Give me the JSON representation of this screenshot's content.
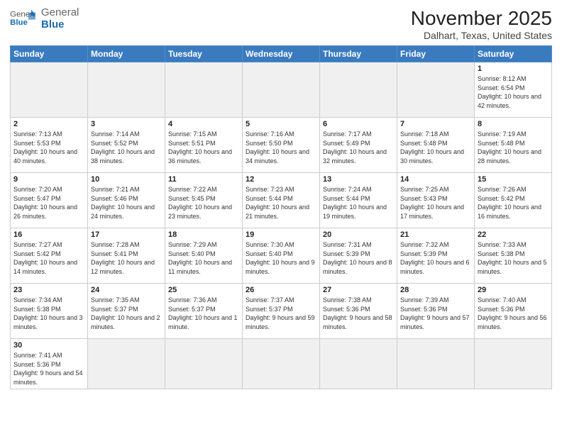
{
  "logo": {
    "text_general": "General",
    "text_blue": "Blue"
  },
  "title": "November 2025",
  "subtitle": "Dalhart, Texas, United States",
  "weekdays": [
    "Sunday",
    "Monday",
    "Tuesday",
    "Wednesday",
    "Thursday",
    "Friday",
    "Saturday"
  ],
  "weeks": [
    [
      {
        "day": "",
        "info": "",
        "empty": true
      },
      {
        "day": "",
        "info": "",
        "empty": true
      },
      {
        "day": "",
        "info": "",
        "empty": true
      },
      {
        "day": "",
        "info": "",
        "empty": true
      },
      {
        "day": "",
        "info": "",
        "empty": true
      },
      {
        "day": "",
        "info": "",
        "empty": true
      },
      {
        "day": "1",
        "info": "Sunrise: 8:12 AM\nSunset: 6:54 PM\nDaylight: 10 hours\nand 42 minutes.",
        "empty": false
      }
    ],
    [
      {
        "day": "2",
        "info": "Sunrise: 7:13 AM\nSunset: 5:53 PM\nDaylight: 10 hours\nand 40 minutes.",
        "empty": false
      },
      {
        "day": "3",
        "info": "Sunrise: 7:14 AM\nSunset: 5:52 PM\nDaylight: 10 hours\nand 38 minutes.",
        "empty": false
      },
      {
        "day": "4",
        "info": "Sunrise: 7:15 AM\nSunset: 5:51 PM\nDaylight: 10 hours\nand 36 minutes.",
        "empty": false
      },
      {
        "day": "5",
        "info": "Sunrise: 7:16 AM\nSunset: 5:50 PM\nDaylight: 10 hours\nand 34 minutes.",
        "empty": false
      },
      {
        "day": "6",
        "info": "Sunrise: 7:17 AM\nSunset: 5:49 PM\nDaylight: 10 hours\nand 32 minutes.",
        "empty": false
      },
      {
        "day": "7",
        "info": "Sunrise: 7:18 AM\nSunset: 5:48 PM\nDaylight: 10 hours\nand 30 minutes.",
        "empty": false
      },
      {
        "day": "8",
        "info": "Sunrise: 7:19 AM\nSunset: 5:48 PM\nDaylight: 10 hours\nand 28 minutes.",
        "empty": false
      }
    ],
    [
      {
        "day": "9",
        "info": "Sunrise: 7:20 AM\nSunset: 5:47 PM\nDaylight: 10 hours\nand 26 minutes.",
        "empty": false
      },
      {
        "day": "10",
        "info": "Sunrise: 7:21 AM\nSunset: 5:46 PM\nDaylight: 10 hours\nand 24 minutes.",
        "empty": false
      },
      {
        "day": "11",
        "info": "Sunrise: 7:22 AM\nSunset: 5:45 PM\nDaylight: 10 hours\nand 23 minutes.",
        "empty": false
      },
      {
        "day": "12",
        "info": "Sunrise: 7:23 AM\nSunset: 5:44 PM\nDaylight: 10 hours\nand 21 minutes.",
        "empty": false
      },
      {
        "day": "13",
        "info": "Sunrise: 7:24 AM\nSunset: 5:44 PM\nDaylight: 10 hours\nand 19 minutes.",
        "empty": false
      },
      {
        "day": "14",
        "info": "Sunrise: 7:25 AM\nSunset: 5:43 PM\nDaylight: 10 hours\nand 17 minutes.",
        "empty": false
      },
      {
        "day": "15",
        "info": "Sunrise: 7:26 AM\nSunset: 5:42 PM\nDaylight: 10 hours\nand 16 minutes.",
        "empty": false
      }
    ],
    [
      {
        "day": "16",
        "info": "Sunrise: 7:27 AM\nSunset: 5:42 PM\nDaylight: 10 hours\nand 14 minutes.",
        "empty": false
      },
      {
        "day": "17",
        "info": "Sunrise: 7:28 AM\nSunset: 5:41 PM\nDaylight: 10 hours\nand 12 minutes.",
        "empty": false
      },
      {
        "day": "18",
        "info": "Sunrise: 7:29 AM\nSunset: 5:40 PM\nDaylight: 10 hours\nand 11 minutes.",
        "empty": false
      },
      {
        "day": "19",
        "info": "Sunrise: 7:30 AM\nSunset: 5:40 PM\nDaylight: 10 hours\nand 9 minutes.",
        "empty": false
      },
      {
        "day": "20",
        "info": "Sunrise: 7:31 AM\nSunset: 5:39 PM\nDaylight: 10 hours\nand 8 minutes.",
        "empty": false
      },
      {
        "day": "21",
        "info": "Sunrise: 7:32 AM\nSunset: 5:39 PM\nDaylight: 10 hours\nand 6 minutes.",
        "empty": false
      },
      {
        "day": "22",
        "info": "Sunrise: 7:33 AM\nSunset: 5:38 PM\nDaylight: 10 hours\nand 5 minutes.",
        "empty": false
      }
    ],
    [
      {
        "day": "23",
        "info": "Sunrise: 7:34 AM\nSunset: 5:38 PM\nDaylight: 10 hours\nand 3 minutes.",
        "empty": false
      },
      {
        "day": "24",
        "info": "Sunrise: 7:35 AM\nSunset: 5:37 PM\nDaylight: 10 hours\nand 2 minutes.",
        "empty": false
      },
      {
        "day": "25",
        "info": "Sunrise: 7:36 AM\nSunset: 5:37 PM\nDaylight: 10 hours\nand 1 minute.",
        "empty": false
      },
      {
        "day": "26",
        "info": "Sunrise: 7:37 AM\nSunset: 5:37 PM\nDaylight: 9 hours\nand 59 minutes.",
        "empty": false
      },
      {
        "day": "27",
        "info": "Sunrise: 7:38 AM\nSunset: 5:36 PM\nDaylight: 9 hours\nand 58 minutes.",
        "empty": false
      },
      {
        "day": "28",
        "info": "Sunrise: 7:39 AM\nSunset: 5:36 PM\nDaylight: 9 hours\nand 57 minutes.",
        "empty": false
      },
      {
        "day": "29",
        "info": "Sunrise: 7:40 AM\nSunset: 5:36 PM\nDaylight: 9 hours\nand 56 minutes.",
        "empty": false
      }
    ],
    [
      {
        "day": "30",
        "info": "Sunrise: 7:41 AM\nSunset: 5:36 PM\nDaylight: 9 hours\nand 54 minutes.",
        "empty": false
      },
      {
        "day": "",
        "info": "",
        "empty": true
      },
      {
        "day": "",
        "info": "",
        "empty": true
      },
      {
        "day": "",
        "info": "",
        "empty": true
      },
      {
        "day": "",
        "info": "",
        "empty": true
      },
      {
        "day": "",
        "info": "",
        "empty": true
      },
      {
        "day": "",
        "info": "",
        "empty": true
      }
    ]
  ]
}
